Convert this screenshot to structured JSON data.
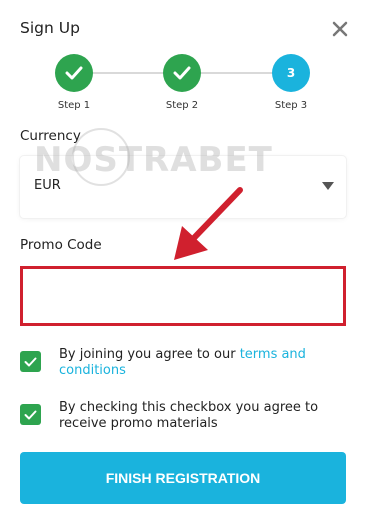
{
  "header": {
    "title": "Sign Up",
    "close_icon": "close-icon"
  },
  "steps": [
    {
      "label": "Step 1",
      "state": "done",
      "icon": "check-icon"
    },
    {
      "label": "Step 2",
      "state": "done",
      "icon": "check-icon"
    },
    {
      "label": "Step 3",
      "state": "active",
      "number": "3"
    }
  ],
  "currency": {
    "label": "Currency",
    "value": "EUR"
  },
  "watermark": "NOSTRABET",
  "promo": {
    "label": "Promo Code",
    "value": "",
    "placeholder": ""
  },
  "agreements": [
    {
      "text": "By joining you agree to our ",
      "link": "terms and conditions",
      "checked": true
    },
    {
      "text": "By checking this checkbox you agree to receive promo materials",
      "checked": true
    }
  ],
  "finish_button": {
    "label": "FINISH REGISTRATION"
  },
  "colors": {
    "accent": "#1ab3dd",
    "success": "#2ea44f",
    "highlight": "#d0202e"
  }
}
